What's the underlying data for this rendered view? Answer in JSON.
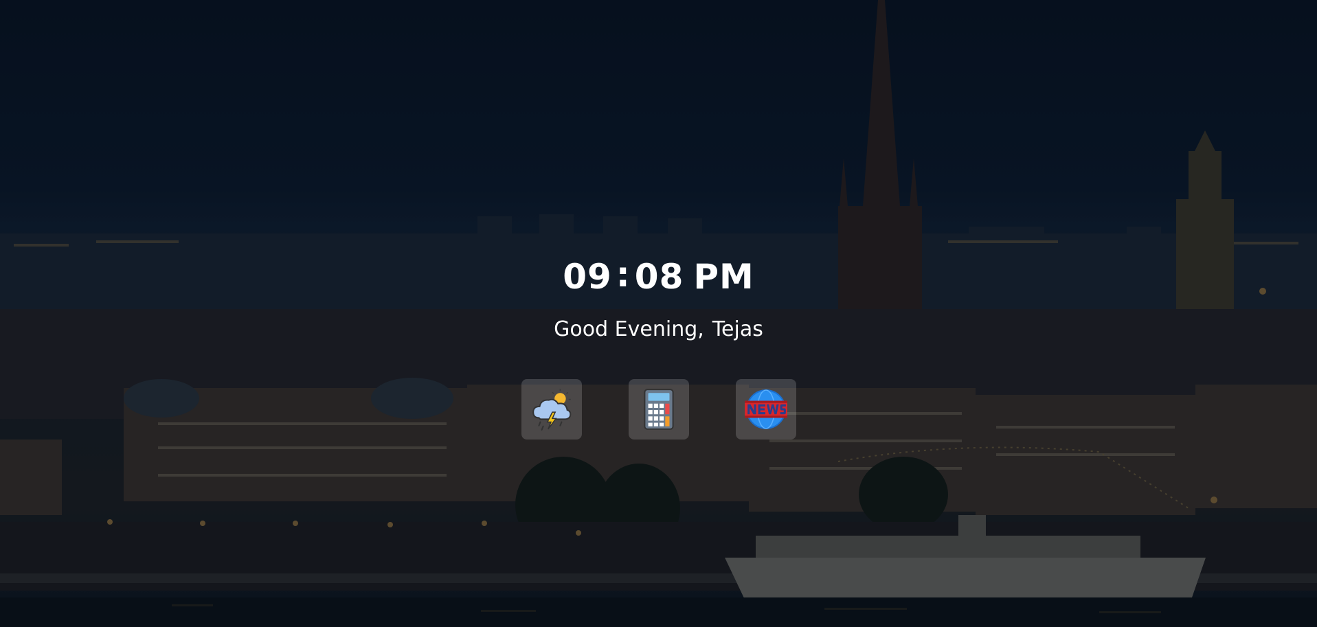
{
  "clock": {
    "hours": "09",
    "separator": ":",
    "minutes": "08",
    "ampm": "PM"
  },
  "greeting": {
    "text": "Good Evening,",
    "name": "Tejas"
  },
  "apps": [
    {
      "name": "weather",
      "icon": "weather-storm-icon"
    },
    {
      "name": "calculator",
      "icon": "calculator-icon"
    },
    {
      "name": "news",
      "icon": "news-globe-icon"
    }
  ],
  "colors": {
    "overlay": "#0b1424",
    "text": "#ffffff",
    "tile": "rgba(255,255,255,0.17)"
  }
}
